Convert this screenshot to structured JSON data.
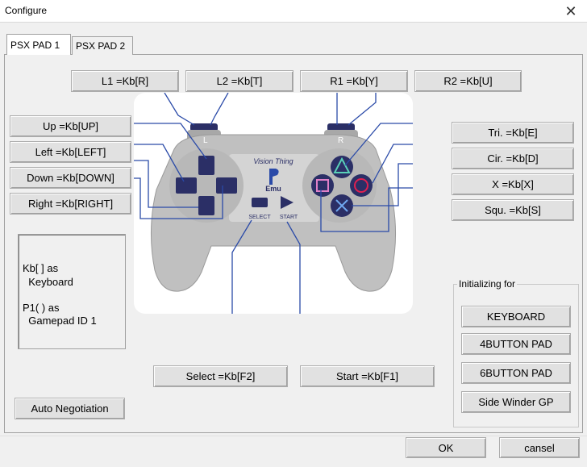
{
  "window": {
    "title": "Configure",
    "close_glyph": "✕"
  },
  "tabs": [
    {
      "label": "PSX PAD 1",
      "active": true
    },
    {
      "label": "PSX PAD 2",
      "active": false
    }
  ],
  "shoulder": {
    "l1": "L1 =Kb[R]",
    "l2": "L2 =Kb[T]",
    "r1": "R1 =Kb[Y]",
    "r2": "R2 =Kb[U]"
  },
  "dpad": {
    "up": "Up =Kb[UP]",
    "left": "Left =Kb[LEFT]",
    "down": "Down =Kb[DOWN]",
    "right": "Right =Kb[RIGHT]"
  },
  "face": {
    "tri": "Tri. =Kb[E]",
    "cir": "Cir. =Kb[D]",
    "x": "X =Kb[X]",
    "squ": "Squ. =Kb[S]"
  },
  "center": {
    "select": "Select =Kb[F2]",
    "start": "Start =Kb[F1]"
  },
  "info": {
    "line1": "Kb[ ] as",
    "line2": "  Keyboard",
    "line3": "P1( ) as",
    "line4": "  Gamepad ID 1"
  },
  "auto_negotiation": "Auto Negotiation",
  "init_group": {
    "label": "Initializing for",
    "buttons": [
      "KEYBOARD",
      "4BUTTON PAD",
      "6BUTTON PAD",
      "Side Winder GP"
    ]
  },
  "pad_image": {
    "brand": "Vision Thing",
    "emu": "Emu",
    "select_text": "SELECT",
    "start_text": "START",
    "l_text": "L",
    "r_text": "R",
    "body_color": "#c0c0c0",
    "accent_color": "#2a4aa8",
    "button_color": "#2b2f66"
  },
  "footer": {
    "ok": "OK",
    "cancel": "cansel"
  }
}
